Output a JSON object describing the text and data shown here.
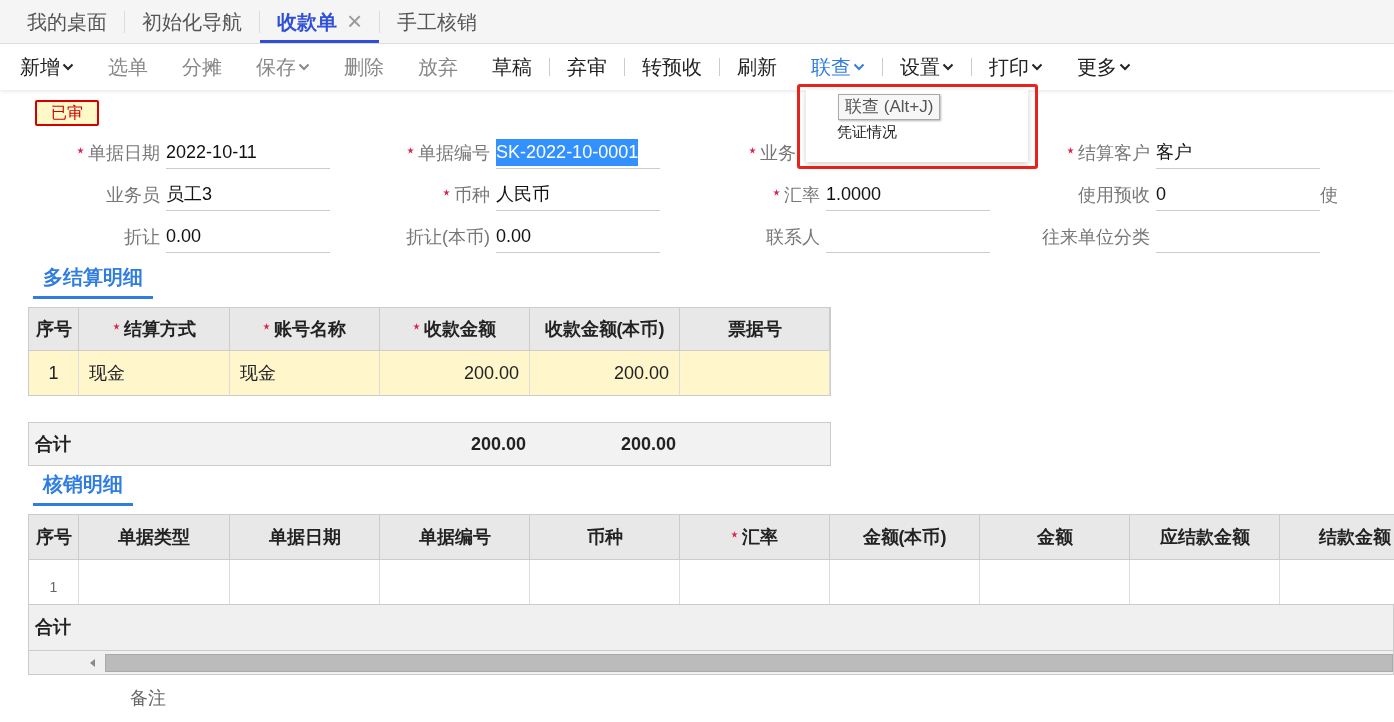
{
  "tabs": [
    {
      "label": "我的桌面",
      "selected": false,
      "closable": false
    },
    {
      "label": "初始化导航",
      "selected": false,
      "closable": false
    },
    {
      "label": "收款单",
      "selected": true,
      "closable": true,
      "close_glyph": "×"
    },
    {
      "label": "手工核销",
      "selected": false,
      "closable": false
    }
  ],
  "toolbar": [
    {
      "label": "新增",
      "enabled": true,
      "dropdown": true,
      "active": false,
      "divider_before": false
    },
    {
      "label": "选单",
      "enabled": false,
      "dropdown": false,
      "active": false,
      "divider_before": false
    },
    {
      "label": "分摊",
      "enabled": false,
      "dropdown": false,
      "active": false,
      "divider_before": false
    },
    {
      "label": "保存",
      "enabled": false,
      "dropdown": true,
      "active": false,
      "divider_before": false
    },
    {
      "label": "删除",
      "enabled": false,
      "dropdown": false,
      "active": false,
      "divider_before": false
    },
    {
      "label": "放弃",
      "enabled": false,
      "dropdown": false,
      "active": false,
      "divider_before": false
    },
    {
      "label": "草稿",
      "enabled": true,
      "dropdown": false,
      "active": false,
      "divider_before": false
    },
    {
      "label": "弃审",
      "enabled": true,
      "dropdown": false,
      "active": false,
      "divider_before": true
    },
    {
      "label": "转预收",
      "enabled": true,
      "dropdown": false,
      "active": false,
      "divider_before": true
    },
    {
      "label": "刷新",
      "enabled": true,
      "dropdown": false,
      "active": false,
      "divider_before": true
    },
    {
      "label": "联查",
      "enabled": true,
      "dropdown": true,
      "active": true,
      "divider_before": false
    },
    {
      "label": "设置",
      "enabled": true,
      "dropdown": true,
      "active": false,
      "divider_before": true
    },
    {
      "label": "打印",
      "enabled": true,
      "dropdown": true,
      "active": false,
      "divider_before": true
    },
    {
      "label": "更多",
      "enabled": true,
      "dropdown": true,
      "active": false,
      "divider_before": false
    }
  ],
  "dropdown_menu": {
    "tooltip": "联查 (Alt+J)",
    "items": [
      "凭证情况"
    ]
  },
  "status_badge": "已审",
  "form_rows": [
    [
      {
        "label": "单据日期",
        "required": true,
        "value": "2022-10-11",
        "highlighted": false
      },
      {
        "label": "单据编号",
        "required": true,
        "value": "SK-2022-10-0001",
        "highlighted": true
      },
      {
        "label": "业务",
        "required": true,
        "partly_hidden": true
      },
      {
        "label": "结算客户",
        "required": true,
        "value": "客户",
        "highlighted": false
      }
    ],
    [
      {
        "label": "业务员",
        "required": false,
        "value": "员工3",
        "highlighted": false
      },
      {
        "label": "币种",
        "required": true,
        "value": "人民币",
        "highlighted": false
      },
      {
        "label": "汇率",
        "required": true,
        "value": "1.0000",
        "highlighted": false
      },
      {
        "label": "使用预收",
        "required": false,
        "value": "0",
        "highlighted": false
      },
      {
        "label": "使",
        "required": false
      }
    ],
    [
      {
        "label": "折让",
        "required": false,
        "value": "0.00",
        "highlighted": false
      },
      {
        "label": "折让(本币)",
        "required": false,
        "value": "0.00",
        "highlighted": false
      },
      {
        "label": "联系人",
        "required": false
      },
      {
        "label": "往来单位分类",
        "required": false
      }
    ]
  ],
  "settlement": {
    "title": "多结算明细",
    "columns": [
      {
        "label": "序号",
        "required": false
      },
      {
        "label": "结算方式",
        "required": true
      },
      {
        "label": "账号名称",
        "required": true
      },
      {
        "label": "收款金额",
        "required": true
      },
      {
        "label": "收款金额(本币)",
        "required": false
      },
      {
        "label": "票据号",
        "required": false
      }
    ],
    "rows": [
      [
        "1",
        "现金",
        "现金",
        "200.00",
        "200.00"
      ]
    ],
    "totals": {
      "label": "合计",
      "amount": "200.00",
      "amount_base": "200.00"
    }
  },
  "writeoff": {
    "title": "核销明细",
    "columns": [
      {
        "label": "序号",
        "required": false
      },
      {
        "label": "单据类型",
        "required": false
      },
      {
        "label": "单据日期",
        "required": false
      },
      {
        "label": "单据编号",
        "required": false
      },
      {
        "label": "币种",
        "required": false
      },
      {
        "label": "汇率",
        "required": true
      },
      {
        "label": "金额(本币)",
        "required": false
      },
      {
        "label": "金额",
        "required": false
      },
      {
        "label": "应结款金额",
        "required": false
      },
      {
        "label": "结款金额",
        "required": false
      }
    ],
    "rows": [
      [
        "1"
      ]
    ],
    "totals_label": "合计"
  },
  "remarks_label": "备注"
}
